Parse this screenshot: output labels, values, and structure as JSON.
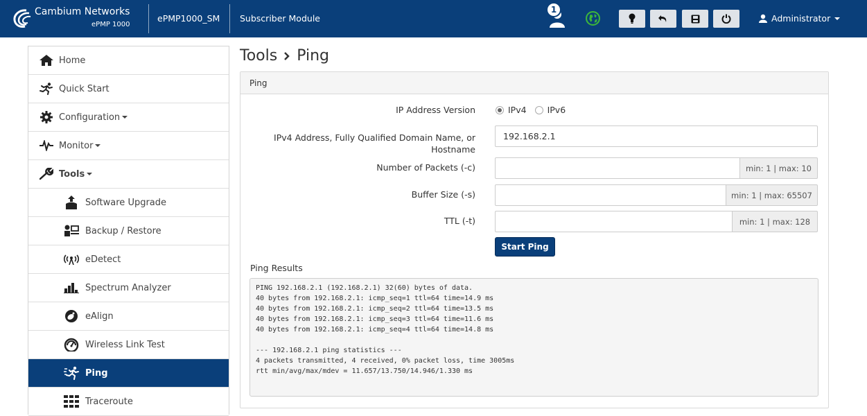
{
  "header": {
    "brand": "Cambium Networks",
    "model": "ePMP 1000",
    "device_name": "ePMP1000_SM",
    "mode": "Subscriber Module",
    "users_count": "1",
    "user": "Administrator"
  },
  "colors": {
    "primary": "#0a3f7a",
    "globe": "#3cb53c",
    "active_nav": "#0a3f7a"
  },
  "sidebar": {
    "items": [
      {
        "label": "Home",
        "icon": "home-icon"
      },
      {
        "label": "Quick Start",
        "icon": "running-man-icon"
      },
      {
        "label": "Configuration",
        "icon": "gear-icon"
      },
      {
        "label": "Monitor",
        "icon": "heartbeat-icon"
      },
      {
        "label": "Tools",
        "icon": "wrench-icon"
      },
      {
        "label": "Software Upgrade",
        "icon": "software-upgrade-icon"
      },
      {
        "label": "Backup / Restore",
        "icon": "backup-restore-icon"
      },
      {
        "label": "eDetect",
        "icon": "antenna-icon"
      },
      {
        "label": "Spectrum Analyzer",
        "icon": "bar-chart-icon"
      },
      {
        "label": "eAlign",
        "icon": "dish-icon"
      },
      {
        "label": "Wireless Link Test",
        "icon": "speedometer-icon"
      },
      {
        "label": "Ping",
        "icon": "ping-icon"
      },
      {
        "label": "Traceroute",
        "icon": "traceroute-icon"
      }
    ]
  },
  "main": {
    "breadcrumb_parent": "Tools",
    "breadcrumb_current": "Ping",
    "panel_title": "Ping",
    "form": {
      "ip_version_label": "IP Address Version",
      "ipv4_label": "IPv4",
      "ipv6_label": "IPv6",
      "address_label": "IPv4 Address, Fully Qualified Domain Name, or Hostname",
      "address_value": "192.168.2.1",
      "packets_label": "Number of Packets (-c)",
      "packets_value": "",
      "packets_hint": "min: 1 | max: 10",
      "buffer_label": "Buffer Size (-s)",
      "buffer_value": "",
      "buffer_hint": "min: 1 | max: 65507",
      "ttl_label": "TTL (-t)",
      "ttl_value": "",
      "ttl_hint": "min: 1 | max: 128",
      "start_label": "Start Ping"
    },
    "results_label": "Ping Results",
    "results_text": "PING 192.168.2.1 (192.168.2.1) 32(60) bytes of data.\n40 bytes from 192.168.2.1: icmp_seq=1 ttl=64 time=14.9 ms\n40 bytes from 192.168.2.1: icmp_seq=2 ttl=64 time=13.5 ms\n40 bytes from 192.168.2.1: icmp_seq=3 ttl=64 time=11.6 ms\n40 bytes from 192.168.2.1: icmp_seq=4 ttl=64 time=14.8 ms\n\n--- 192.168.2.1 ping statistics ---\n4 packets transmitted, 4 received, 0% packet loss, time 3005ms\nrtt min/avg/max/mdev = 11.657/13.750/14.946/1.330 ms"
  }
}
